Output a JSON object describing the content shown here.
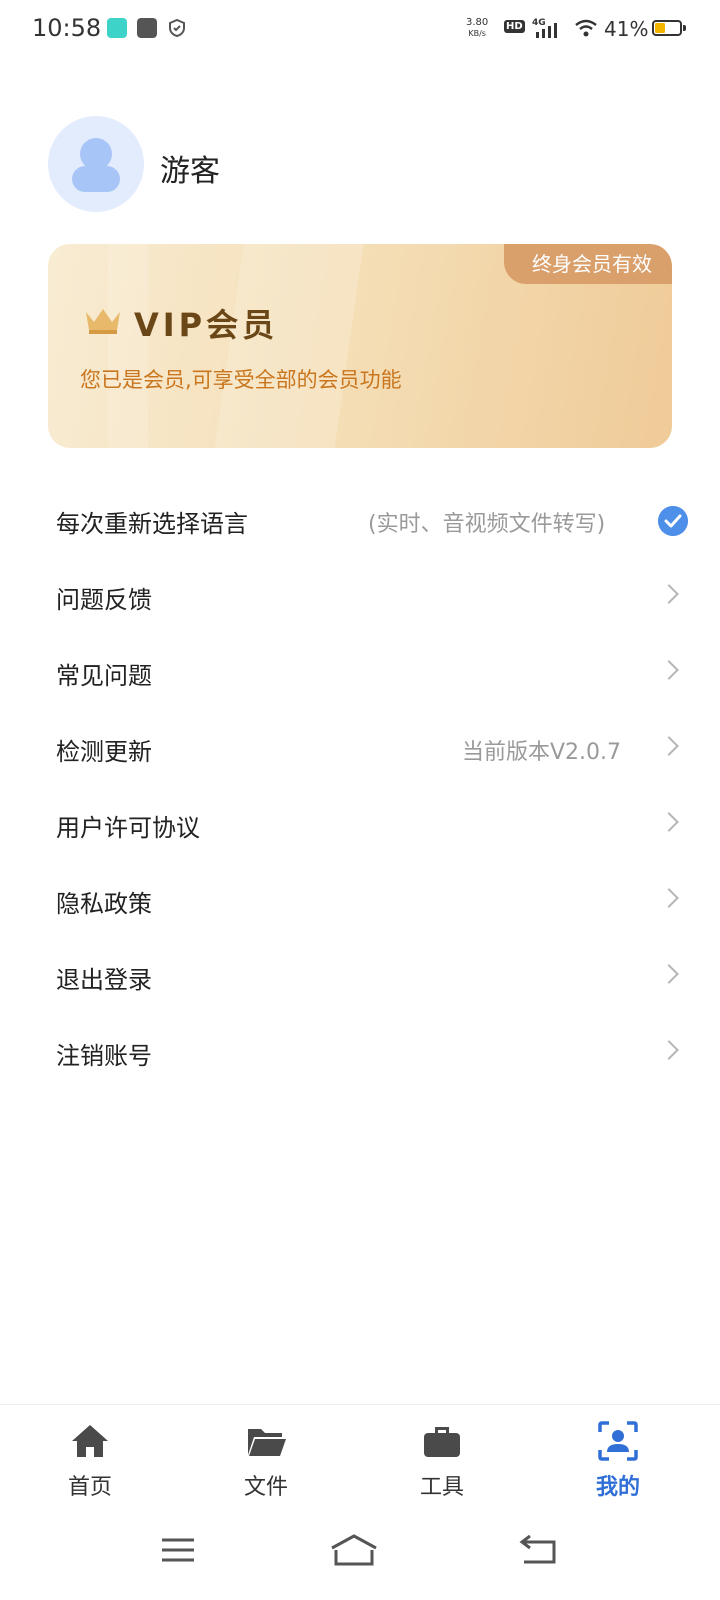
{
  "status_bar": {
    "time": "10:58",
    "speed_value": "3.80",
    "speed_unit": "KB/s",
    "hd": "HD",
    "network": "4G",
    "battery": "41%"
  },
  "profile": {
    "name": "游客"
  },
  "vip": {
    "badge": "终身会员有效",
    "title": "VIP会员",
    "description": "您已是会员,可享受全部的会员功能"
  },
  "menu": {
    "items": [
      {
        "label": "每次重新选择语言",
        "value": "(实时、音视频文件转写)"
      },
      {
        "label": "问题反馈",
        "value": ""
      },
      {
        "label": "常见问题",
        "value": ""
      },
      {
        "label": "检测更新",
        "value": "当前版本V2.0.7"
      },
      {
        "label": "用户许可协议",
        "value": ""
      },
      {
        "label": "隐私政策",
        "value": ""
      },
      {
        "label": "退出登录",
        "value": ""
      },
      {
        "label": "注销账号",
        "value": ""
      }
    ]
  },
  "nav": {
    "tabs": [
      {
        "label": "首页",
        "icon": "home-icon"
      },
      {
        "label": "文件",
        "icon": "folder-icon"
      },
      {
        "label": "工具",
        "icon": "briefcase-icon"
      },
      {
        "label": "我的",
        "icon": "profile-icon"
      }
    ],
    "active_tab": "我的"
  },
  "colors": {
    "accent": "#2f6fd6",
    "vip_badge": "#d9a06c",
    "vip_text": "#c9761e",
    "checkbox": "#4d8fe9"
  }
}
